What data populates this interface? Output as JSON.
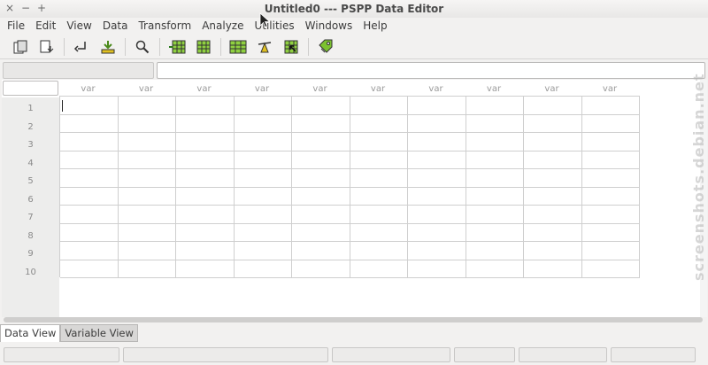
{
  "window": {
    "title": "Untitled0 --- PSPP Data Editor",
    "controls": [
      "×",
      "−",
      "+"
    ]
  },
  "menu": [
    "File",
    "Edit",
    "View",
    "Data",
    "Transform",
    "Analyze",
    "Utilities",
    "Windows",
    "Help"
  ],
  "toolbar": {
    "icons": [
      "open-icon",
      "save-icon",
      "goto-case-icon",
      "goto-variable-icon",
      "find-icon",
      "insert-case-icon",
      "insert-variable-icon",
      "split-file-icon",
      "weight-cases-icon",
      "select-cases-icon",
      "value-labels-icon"
    ]
  },
  "sheet": {
    "column_header": "var",
    "rows": [
      "1",
      "2",
      "3",
      "4",
      "5",
      "6",
      "7",
      "8",
      "9",
      "10"
    ]
  },
  "tabs": {
    "data_view": "Data View",
    "variable_view": "Variable View"
  },
  "watermark": "screenshots.debian.net",
  "colors": {
    "grid_line": "#cfcfcf",
    "toolbar_accent": "#7cc230"
  }
}
